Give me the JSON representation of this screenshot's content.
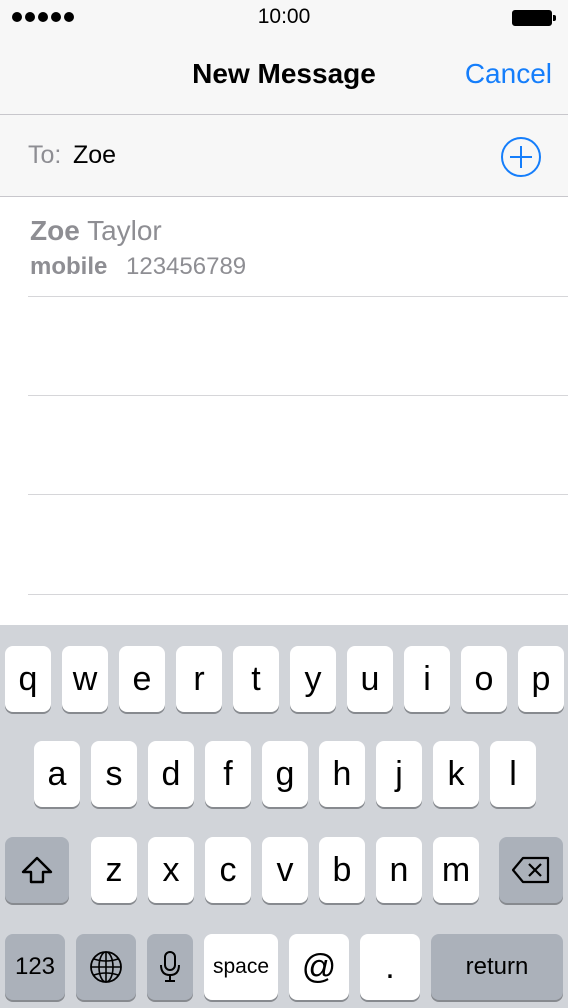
{
  "status_bar": {
    "time": "10:00",
    "signal_icon": "signal-dots-icon",
    "battery_icon": "battery-icon"
  },
  "nav": {
    "title": "New Message",
    "cancel_label": "Cancel"
  },
  "to_field": {
    "label": "To:",
    "value": "Zoe",
    "add_icon": "plus-circle-icon"
  },
  "suggestion": {
    "first_name": "Zoe",
    "last_name": "Taylor",
    "phone_kind": "mobile",
    "phone_number": "123456789"
  },
  "keyboard": {
    "row1": [
      "q",
      "w",
      "e",
      "r",
      "t",
      "y",
      "u",
      "i",
      "o",
      "p"
    ],
    "row2": [
      "a",
      "s",
      "d",
      "f",
      "g",
      "h",
      "j",
      "k",
      "l"
    ],
    "row3": [
      "z",
      "x",
      "c",
      "v",
      "b",
      "n",
      "m"
    ],
    "shift_icon": "shift-icon",
    "delete_icon": "delete-backspace-icon",
    "numbers_label": "123",
    "globe_icon": "globe-icon",
    "mic_icon": "microphone-icon",
    "space_label": "space",
    "at_label": "@",
    "period_label": ".",
    "return_label": "return"
  },
  "colors": {
    "accent": "#157efb",
    "secondary_text": "#8e8e93",
    "keyboard_bg": "#d1d4d9",
    "key_dark": "#abb1ba"
  }
}
